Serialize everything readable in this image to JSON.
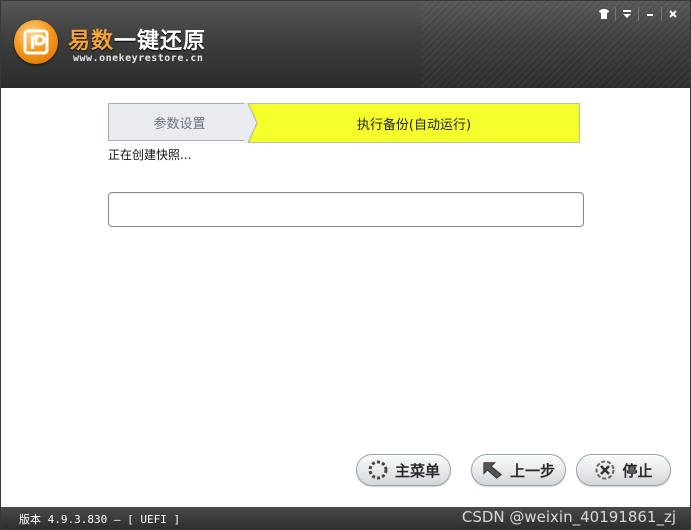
{
  "header": {
    "brand_orange": "易数",
    "brand_white": "一键还原",
    "url": "www.onekeyrestore.cn",
    "controls": {
      "skin": "skin-icon",
      "menu": "menu-icon",
      "minimize": "minimize-icon",
      "close": "close-icon"
    }
  },
  "steps": [
    {
      "label": "参数设置",
      "state": "done"
    },
    {
      "label": "执行备份(自动运行)",
      "state": "active",
      "color": "#f4ff2c"
    }
  ],
  "status_text": "正在创建快照...",
  "progress": {
    "value": 0
  },
  "buttons": {
    "main_menu": "主菜单",
    "back": "上一步",
    "stop": "停止"
  },
  "statusbar": {
    "version": "版本 4.9.3.830 — [ UEFI ]",
    "watermark": "CSDN @weixin_40191861_zj"
  }
}
